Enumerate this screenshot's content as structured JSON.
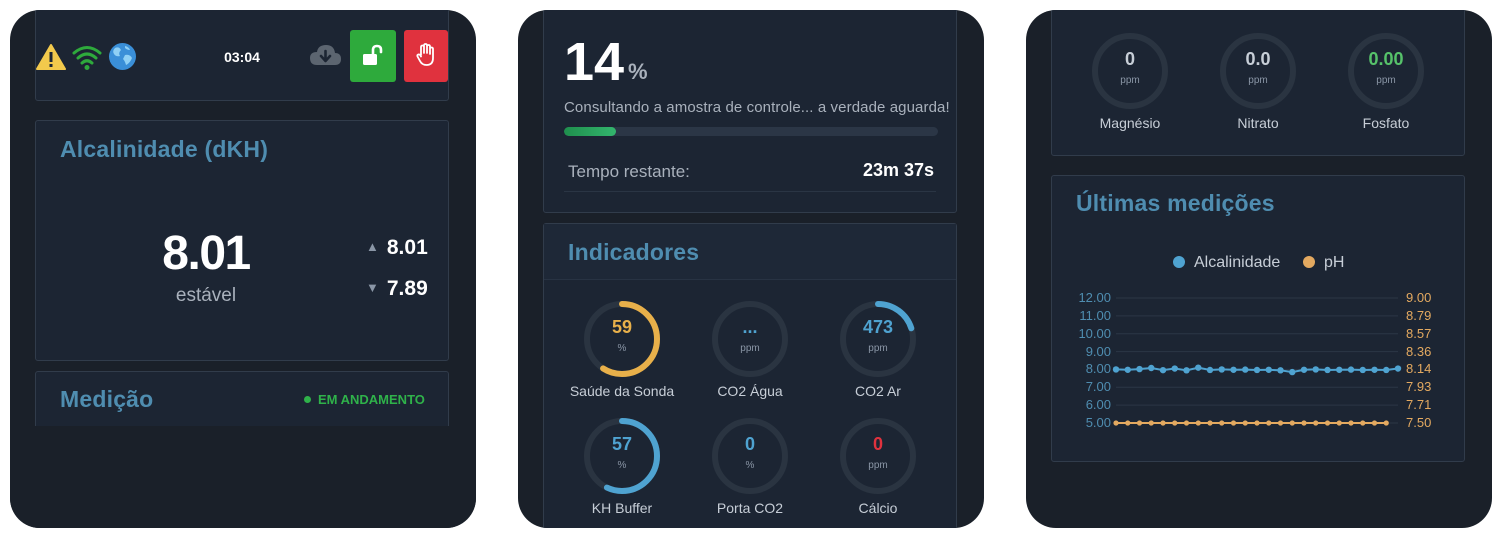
{
  "colors": {
    "background": "#1a2029",
    "card": "#1c2533",
    "title": "#4f8db0",
    "success": "#2eaa3c",
    "danger": "#e0323e",
    "warning": "#f2c94c",
    "alkalinity_series": "#4fa3d1",
    "ph_series": "#e3a960"
  },
  "screen1": {
    "status_bar": {
      "icons": [
        "warning-icon",
        "wifi-icon",
        "globe-icon",
        "cloud-download-icon",
        "unlock-icon",
        "stop-hand-icon"
      ],
      "time": "03:04"
    },
    "alkalinity": {
      "title": "Alcalinidade (dKH)",
      "value": "8.01",
      "trend": "estável",
      "max": "8.01",
      "min": "7.89"
    },
    "measurement": {
      "title": "Medição",
      "status": "EM ANDAMENTO"
    }
  },
  "screen2": {
    "progress": {
      "percent_value": "14",
      "percent_unit": "%",
      "progress_fraction": 0.14,
      "message": "Consultando a amostra de controle... a verdade aguarda!",
      "remaining_label": "Tempo restante:",
      "remaining_value": "23m 37s"
    },
    "indicators": {
      "title": "Indicadores",
      "gauges": [
        {
          "label": "Saúde da Sonda",
          "value": "59",
          "unit": "%",
          "fill": 0.59,
          "color": "#e8b04a",
          "value_color": "#e8b04a"
        },
        {
          "label": "CO2 Água",
          "value": "...",
          "unit": "ppm",
          "fill": 0,
          "color": "#4fa3d1",
          "value_color": "#4fa3d1"
        },
        {
          "label": "CO2 Ar",
          "value": "473",
          "unit": "ppm",
          "fill": 0.2,
          "color": "#4fa3d1",
          "value_color": "#4fa3d1"
        },
        {
          "label": "KH Buffer",
          "value": "57",
          "unit": "%",
          "fill": 0.57,
          "color": "#4fa3d1",
          "value_color": "#4fa3d1"
        },
        {
          "label": "Porta CO2",
          "value": "0",
          "unit": "%",
          "fill": 0,
          "color": "#4fa3d1",
          "value_color": "#4fa3d1"
        },
        {
          "label": "Cálcio",
          "value": "0",
          "unit": "ppm",
          "fill": 0,
          "color": "#e0323e",
          "value_color": "#e0323e"
        }
      ]
    }
  },
  "screen3": {
    "mini_gauges": [
      {
        "label": "Magnésio",
        "value": "0",
        "unit": "ppm",
        "value_color": "#c7ced7"
      },
      {
        "label": "Nitrato",
        "value": "0.0",
        "unit": "ppm",
        "value_color": "#c7ced7"
      },
      {
        "label": "Fosfato",
        "value": "0.00",
        "unit": "ppm",
        "value_color": "#56c26a"
      }
    ],
    "chart_title": "Últimas medições",
    "legend": [
      {
        "name": "Alcalinidade",
        "color": "#4fa3d1"
      },
      {
        "name": "pH",
        "color": "#e3a960"
      }
    ]
  },
  "chart_data": {
    "type": "line",
    "title": "Últimas medições",
    "grid": true,
    "legend_position": "top",
    "y_left_ticks": [
      "12.00",
      "11.00",
      "10.00",
      "9.00",
      "8.00",
      "7.00",
      "6.00",
      "5.00"
    ],
    "y_right_ticks": [
      "9.00",
      "8.79",
      "8.57",
      "8.36",
      "8.14",
      "7.93",
      "7.71",
      "7.50"
    ],
    "y_left_range": [
      5,
      12
    ],
    "y_right_range": [
      7.5,
      9.0
    ],
    "series": [
      {
        "name": "Alcalinidade",
        "axis": "left",
        "values": [
          8.0,
          7.98,
          8.02,
          8.08,
          7.96,
          8.05,
          7.95,
          8.1,
          7.97,
          8.0,
          7.98,
          7.99,
          7.97,
          7.98,
          7.95,
          7.85,
          7.98,
          8.0,
          7.97,
          7.98,
          7.99,
          7.97,
          7.98,
          7.97,
          8.05
        ]
      },
      {
        "name": "pH",
        "axis": "left",
        "values": [
          5.0,
          5.0,
          5.0,
          5.0,
          5.0,
          5.0,
          5.0,
          5.0,
          5.0,
          5.0,
          5.0,
          5.0,
          5.0,
          5.0,
          5.0,
          5.0,
          5.0,
          5.0,
          5.0,
          5.0,
          5.0,
          5.0,
          5.0,
          5.0
        ]
      }
    ]
  }
}
